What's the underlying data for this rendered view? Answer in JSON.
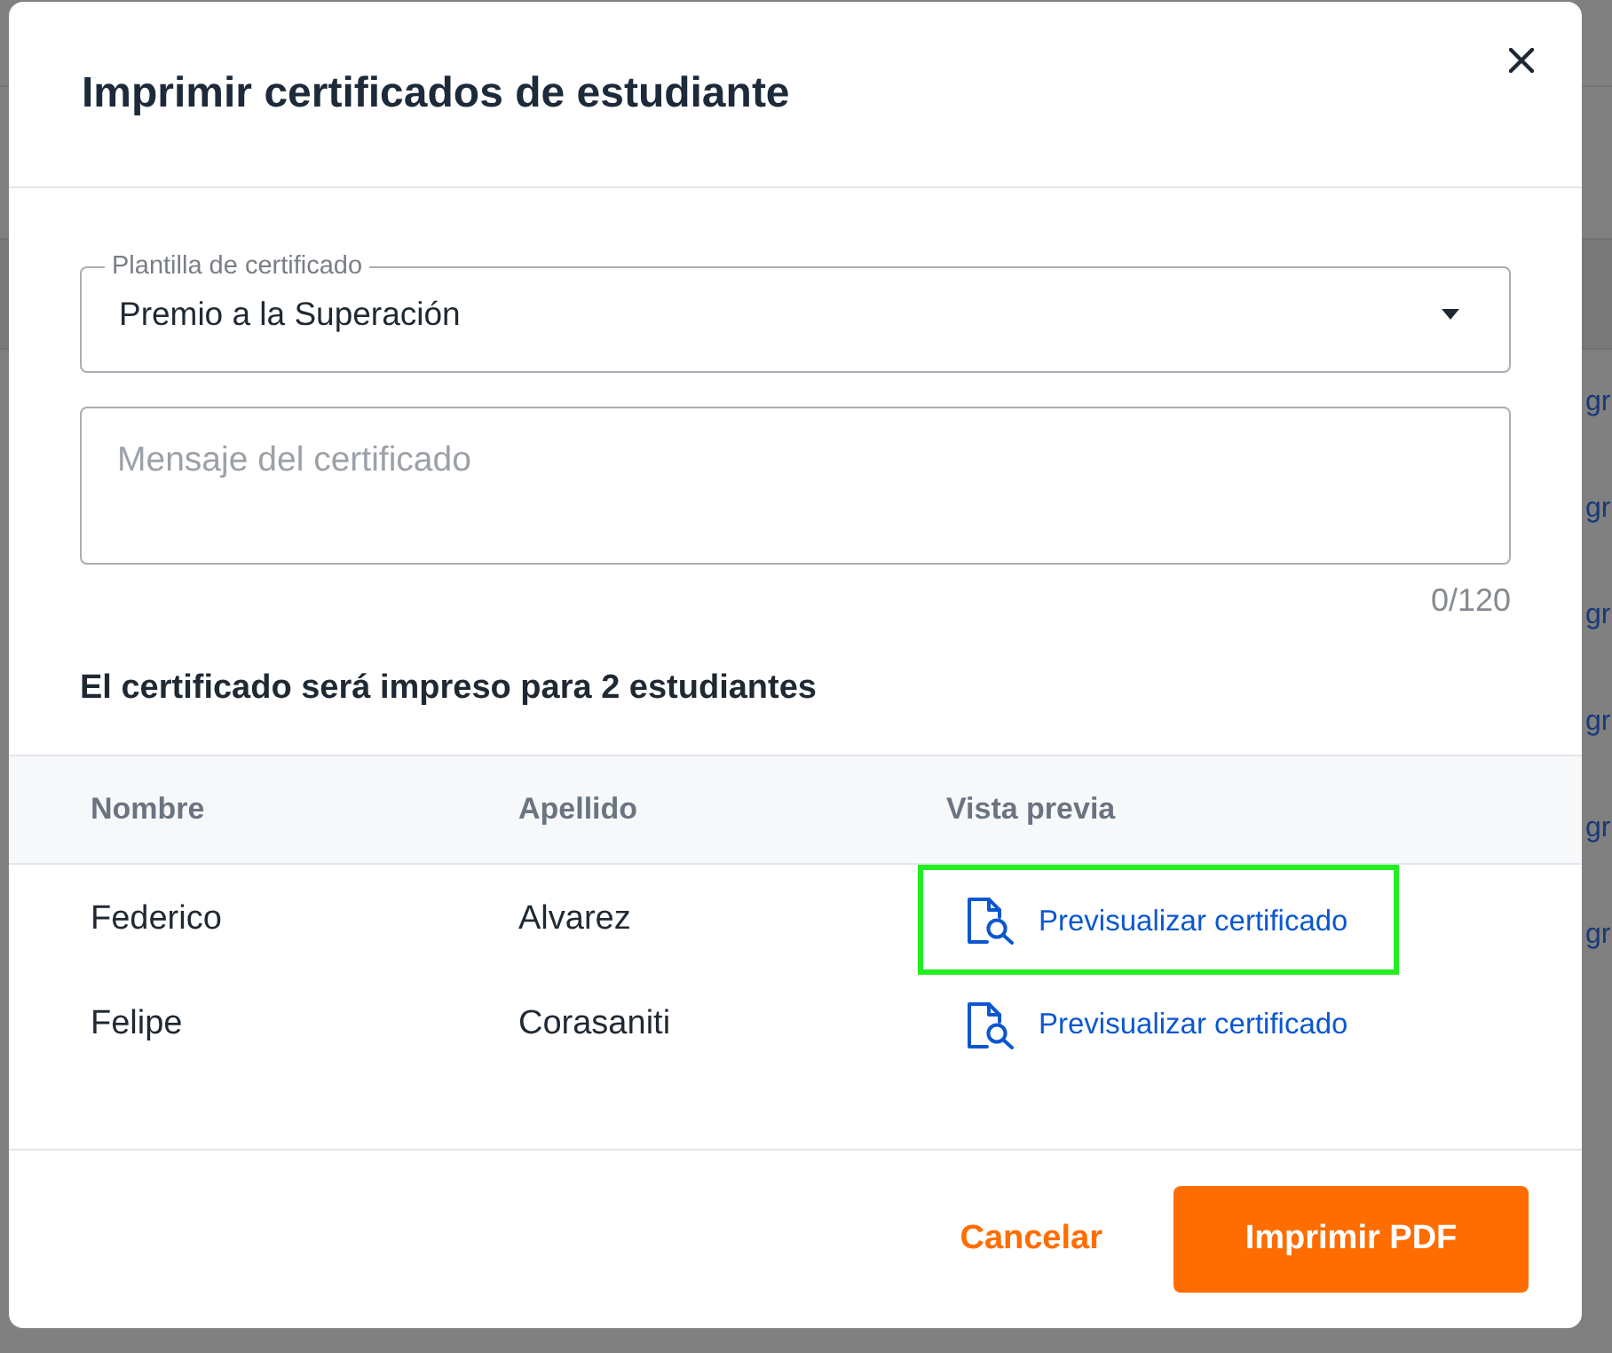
{
  "background_page": {
    "row_links": [
      "gr",
      "gr",
      "gr",
      "gr",
      "gr",
      "gr"
    ]
  },
  "dialog": {
    "title": "Imprimir certificados de estudiante"
  },
  "template_select": {
    "label": "Plantilla de certificado",
    "value": "Premio a la Superación"
  },
  "message_field": {
    "placeholder": "Mensaje del certificado",
    "counter": "0/120"
  },
  "summary": "El certificado será impreso para 2 estudiantes",
  "table": {
    "columns": [
      "Nombre",
      "Apellido",
      "Vista previa"
    ],
    "rows": [
      {
        "first_name": "Federico",
        "last_name": "Alvarez",
        "preview_link": "Previsualizar certificado",
        "highlighted": true
      },
      {
        "first_name": "Felipe",
        "last_name": "Corasaniti",
        "preview_link": "Previsualizar certificado",
        "highlighted": false
      }
    ]
  },
  "footer": {
    "buttons": [
      {
        "label": "Cancelar",
        "kind": "text"
      },
      {
        "label": "Imprimir PDF",
        "kind": "primary"
      }
    ]
  }
}
